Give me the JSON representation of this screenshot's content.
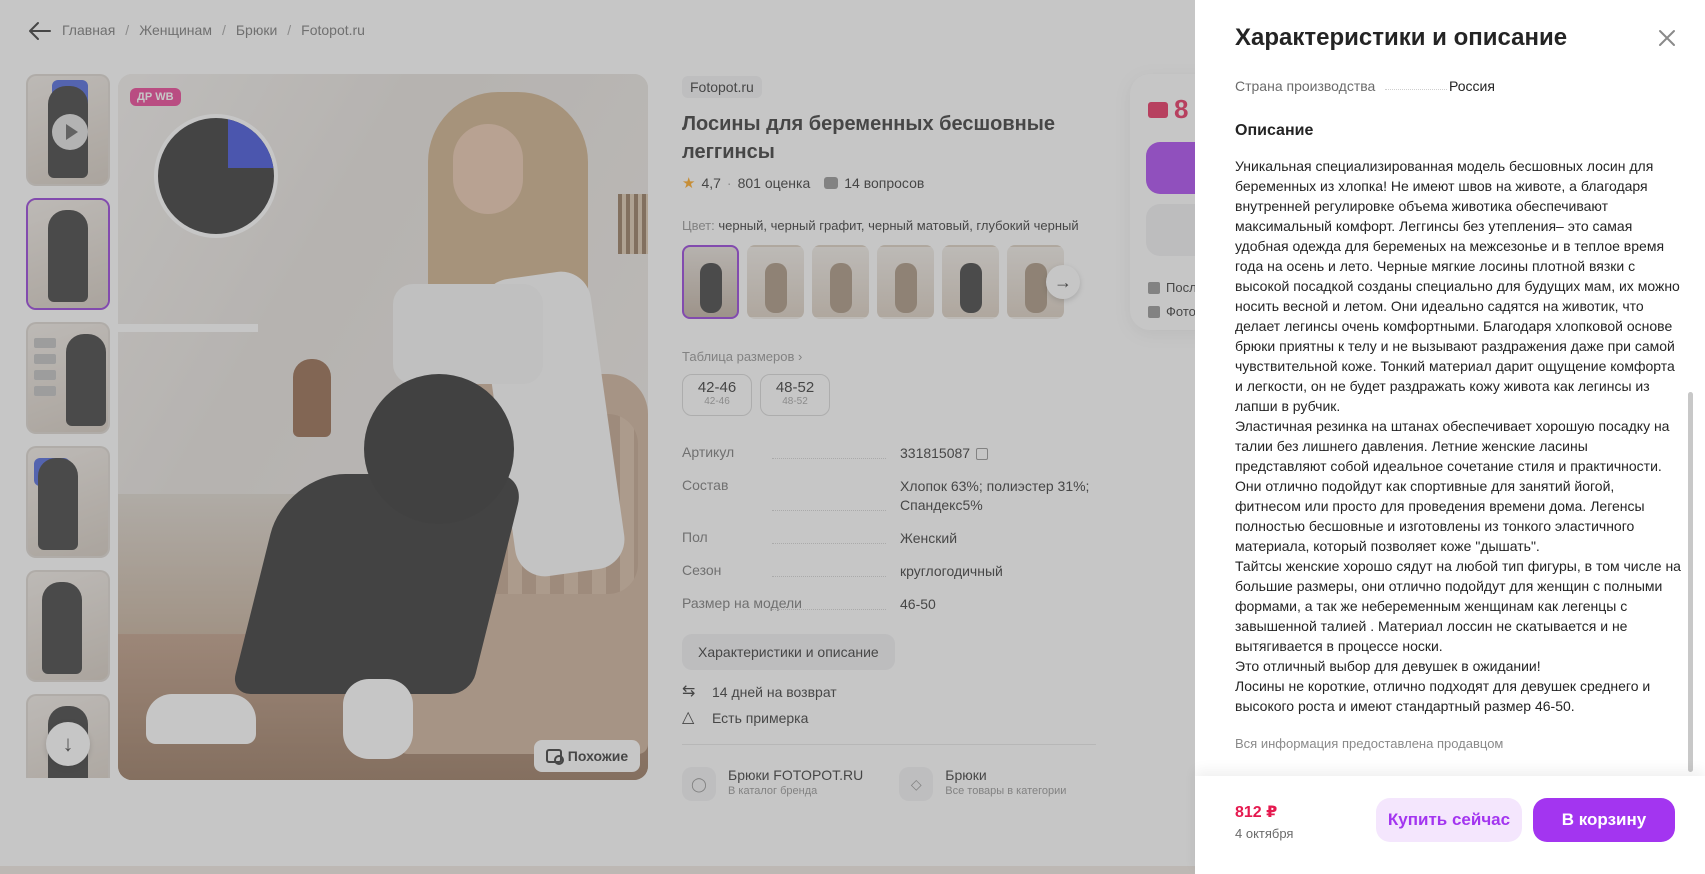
{
  "breadcrumb": [
    "Главная",
    "Женщинам",
    "Брюки",
    "Fotopot.ru"
  ],
  "badge": "ДР WB",
  "similar_label": "Похожие",
  "product": {
    "brand": "Fotopot.ru",
    "title": "Лосины для беременных бесшовные леггинсы",
    "rating": "4,7",
    "ratings_count": "801 оценка",
    "questions": "14 вопросов",
    "color_label": "Цвет:",
    "color_value": "черный, черный графит, черный матовый, глубокий черный",
    "size_table": "Таблица размеров",
    "sizes": [
      {
        "main": "42-46",
        "sub": "42-46"
      },
      {
        "main": "48-52",
        "sub": "48-52"
      }
    ],
    "specs": [
      {
        "key": "Артикул",
        "val": "331815087"
      },
      {
        "key": "Состав",
        "val": "Хлопок 63%; полиэстер 31%; Спандекс5%"
      },
      {
        "key": "Пол",
        "val": "Женский"
      },
      {
        "key": "Сезон",
        "val": "круглогодичный"
      },
      {
        "key": "Размер на модели",
        "val": "46-50"
      }
    ],
    "char_button": "Характеристики и описание",
    "returns": "14 дней на возврат",
    "fitting": "Есть примерка",
    "brand_link_title": "Брюки FOTOPOT.RU",
    "brand_link_sub": "В каталог бренда",
    "category_link_title": "Брюки",
    "category_link_sub": "Все товары в категории"
  },
  "price_card": {
    "price_partial": "8",
    "line1": "Посл",
    "line2": "Фото"
  },
  "panel": {
    "title": "Характеристики и описание",
    "country_key": "Страна производства",
    "country_val": "Россия",
    "desc_heading": "Описание",
    "desc_text": "Уникальная специализированная модель бесшовных лосин для беременных из хлопка! Не имеют швов на животе, а благодаря внутренней регулировке объема животика обеспечивают максимальный комфорт. Леггинсы без утепления– это самая удобная одежда для беременых на межсезонье и в теплое время года на осень и лето. Черные мягкие лосины плотной вязки с высокой посадкой созданы специально для будущих мам, их можно носить весной и летом. Они идеально садятся на животик, что делает легинсы очень комфортными. Благодаря хлопковой основе брюки приятны к телу и не вызывают раздражения даже при самой чувствительной коже. Тонкий материал дарит ощущение комфорта и легкости, он не будет раздражать кожу живота как легинсы из лапши в рубчик.\nЭластичная резинка на штанах обеспечивает хорошую посадку на талии без лишнего давления. Летние женские ласины представляют собой идеальное сочетание стиля и практичности. Они отлично подойдут как спортивные для занятий йогой, фитнесом или просто для проведения времени дома. Легенсы полностью бесшовные и изготовлены из тонкого эластичного материала, который позволяет коже \"дышать\".\nТайтсы женские хорошо сядут на любой тип фигуры, в том числе на большие размеры, они отлично подойдут для женщин с полными формами, а так же небеременным женщинам как легенцы с завышенной талией . Материал лоссин не скатывается и не вытягивается в процессе носки.\nЭто отличный выбор для девушек в ожидании!\nЛосины не короткие, отлично подходят для девушек среднего и высокого роста и имеют стандартный размер 46-50.",
    "seller_note": "Вся информация предоставлена продавцом",
    "price": "812 ₽",
    "date": "4 октября",
    "buy_now": "Купить сейчас",
    "to_cart": "В корзину"
  },
  "colors": {
    "accent": "#a335f0",
    "price": "#e5194f",
    "badge": "#e8308a"
  }
}
